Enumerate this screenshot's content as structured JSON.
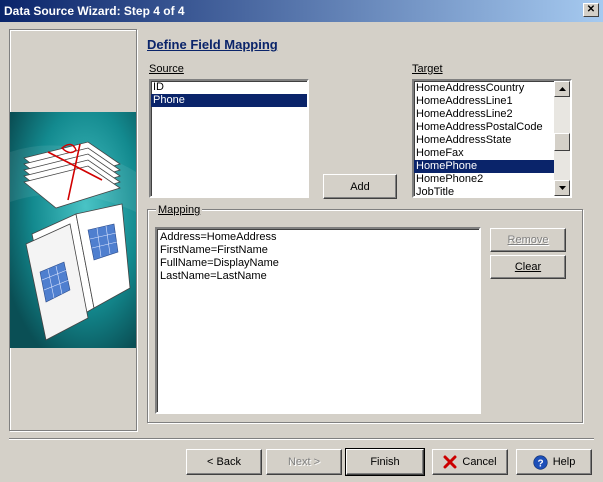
{
  "window": {
    "title": "Data Source Wizard: Step 4 of 4",
    "close_glyph": "✕"
  },
  "heading": "Define Field Mapping",
  "source": {
    "label": "Source",
    "items": [
      {
        "text": "ID",
        "selected": false
      },
      {
        "text": "Phone",
        "selected": true
      }
    ]
  },
  "target": {
    "label": "Target",
    "items": [
      {
        "text": "HomeAddressCountry",
        "selected": false
      },
      {
        "text": "HomeAddressLine1",
        "selected": false
      },
      {
        "text": "HomeAddressLine2",
        "selected": false
      },
      {
        "text": "HomeAddressPostalCode",
        "selected": false
      },
      {
        "text": "HomeAddressState",
        "selected": false
      },
      {
        "text": "HomeFax",
        "selected": false
      },
      {
        "text": "HomePhone",
        "selected": true
      },
      {
        "text": "HomePhone2",
        "selected": false
      },
      {
        "text": "JobTitle",
        "selected": false
      }
    ],
    "scroll_position": 0.55
  },
  "add_button": "Add",
  "mapping": {
    "label": "Mapping",
    "lines": [
      "Address=HomeAddress",
      "FirstName=FirstName",
      "FullName=DisplayName",
      "LastName=LastName"
    ],
    "remove_label": "Remove",
    "clear_label": "Clear"
  },
  "footer": {
    "back": "< Back",
    "next": "Next >",
    "finish": "Finish",
    "cancel": "Cancel",
    "help": "Help"
  },
  "icons": {
    "cancel": "x-icon",
    "help": "help-circle-icon",
    "scroll_up": "up-arrow-icon",
    "scroll_down": "down-arrow-icon"
  },
  "colors": {
    "titlebar_start": "#0a246a",
    "titlebar_end": "#a6caf0",
    "selection": "#0a246a",
    "heading": "#0a246a",
    "art_background": "#0f6d73",
    "cancel_icon": "#cc0000",
    "help_icon": "#1d4fb8"
  }
}
